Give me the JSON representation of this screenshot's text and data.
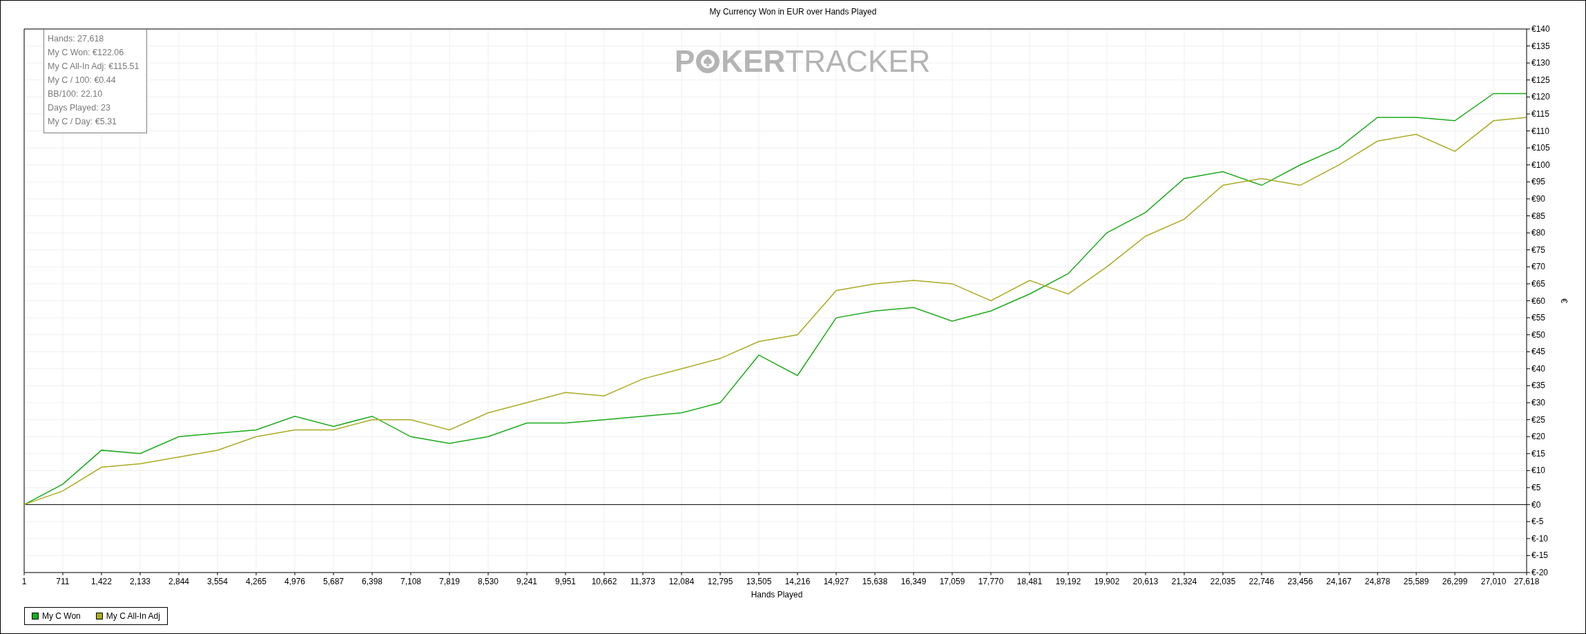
{
  "title": "My Currency Won in EUR over Hands Played",
  "stats": [
    "Hands: 27,618",
    "My C Won: €122.06",
    "My C All-In Adj: €115.51",
    "My C / 100: €0.44",
    "BB/100: 22.10",
    "Days Played: 23",
    "My C / Day: €5.31"
  ],
  "watermark": {
    "first": "P",
    "rest": "**KER**TRACKER"
  },
  "chart_data": {
    "type": "line",
    "grid": true,
    "xlabel": "Hands Played",
    "ylabel": "€",
    "x": [
      1,
      711,
      1422,
      2133,
      2844,
      3554,
      4265,
      4976,
      5687,
      6398,
      7108,
      7819,
      8530,
      9241,
      9951,
      10662,
      11373,
      12084,
      12795,
      13505,
      14216,
      14927,
      15638,
      16349,
      17059,
      17770,
      18481,
      19192,
      19902,
      20613,
      21324,
      22035,
      22746,
      23456,
      24167,
      24878,
      25589,
      26299,
      27010,
      27618
    ],
    "series": [
      {
        "name": "My C Won",
        "color": "#1aaa1a",
        "values": [
          0,
          6,
          16,
          15,
          20,
          21,
          22,
          26,
          23,
          26,
          20,
          18,
          20,
          24,
          24,
          25,
          26,
          27,
          30,
          44,
          38,
          55,
          57,
          58,
          54,
          57,
          62,
          68,
          80,
          86,
          96,
          98,
          94,
          100,
          105,
          114,
          114,
          113,
          121,
          121
        ]
      },
      {
        "name": "My C All-In Adj",
        "color": "#aaaa22",
        "values": [
          0,
          4,
          11,
          12,
          14,
          16,
          20,
          22,
          22,
          25,
          25,
          22,
          27,
          30,
          33,
          32,
          37,
          40,
          43,
          48,
          50,
          63,
          65,
          66,
          65,
          60,
          66,
          62,
          70,
          79,
          84,
          94,
          96,
          94,
          100,
          107,
          109,
          104,
          113,
          114
        ]
      }
    ],
    "xlim": [
      1,
      27618
    ],
    "ylim": [
      -20,
      140
    ],
    "xticks": [
      {
        "value": 1,
        "label": "1"
      },
      {
        "value": 711,
        "label": "711"
      },
      {
        "value": 1422,
        "label": "1,422"
      },
      {
        "value": 2133,
        "label": "2,133"
      },
      {
        "value": 2844,
        "label": "2,844"
      },
      {
        "value": 3554,
        "label": "3,554"
      },
      {
        "value": 4265,
        "label": "4,265"
      },
      {
        "value": 4976,
        "label": "4,976"
      },
      {
        "value": 5687,
        "label": "5,687"
      },
      {
        "value": 6398,
        "label": "6,398"
      },
      {
        "value": 7108,
        "label": "7,108"
      },
      {
        "value": 7819,
        "label": "7,819"
      },
      {
        "value": 8530,
        "label": "8,530"
      },
      {
        "value": 9241,
        "label": "9,241"
      },
      {
        "value": 9951,
        "label": "9,951"
      },
      {
        "value": 10662,
        "label": "10,662"
      },
      {
        "value": 11373,
        "label": "11,373"
      },
      {
        "value": 12084,
        "label": "12,084"
      },
      {
        "value": 12795,
        "label": "12,795"
      },
      {
        "value": 13505,
        "label": "13,505"
      },
      {
        "value": 14216,
        "label": "14,216"
      },
      {
        "value": 14927,
        "label": "14,927"
      },
      {
        "value": 15638,
        "label": "15,638"
      },
      {
        "value": 16349,
        "label": "16,349"
      },
      {
        "value": 17059,
        "label": "17,059"
      },
      {
        "value": 17770,
        "label": "17,770"
      },
      {
        "value": 18481,
        "label": "18,481"
      },
      {
        "value": 19192,
        "label": "19,192"
      },
      {
        "value": 19902,
        "label": "19,902"
      },
      {
        "value": 20613,
        "label": "20,613"
      },
      {
        "value": 21324,
        "label": "21,324"
      },
      {
        "value": 22035,
        "label": "22,035"
      },
      {
        "value": 22746,
        "label": "22,746"
      },
      {
        "value": 23456,
        "label": "23,456"
      },
      {
        "value": 24167,
        "label": "24,167"
      },
      {
        "value": 24878,
        "label": "24,878"
      },
      {
        "value": 25589,
        "label": "25,589"
      },
      {
        "value": 26299,
        "label": "26,299"
      },
      {
        "value": 27010,
        "label": "27,010"
      },
      {
        "value": 27618,
        "label": "27,618"
      }
    ],
    "yticks": [
      {
        "value": -20,
        "label": "€-20"
      },
      {
        "value": -15,
        "label": "€-15"
      },
      {
        "value": -10,
        "label": "€-10"
      },
      {
        "value": -5,
        "label": "€-5"
      },
      {
        "value": 0,
        "label": "€0"
      },
      {
        "value": 5,
        "label": "€5"
      },
      {
        "value": 10,
        "label": "€10"
      },
      {
        "value": 15,
        "label": "€15"
      },
      {
        "value": 20,
        "label": "€20"
      },
      {
        "value": 25,
        "label": "€25"
      },
      {
        "value": 30,
        "label": "€30"
      },
      {
        "value": 35,
        "label": "€35"
      },
      {
        "value": 40,
        "label": "€40"
      },
      {
        "value": 45,
        "label": "€45"
      },
      {
        "value": 50,
        "label": "€50"
      },
      {
        "value": 55,
        "label": "€55"
      },
      {
        "value": 60,
        "label": "€60"
      },
      {
        "value": 65,
        "label": "€65"
      },
      {
        "value": 70,
        "label": "€70"
      },
      {
        "value": 75,
        "label": "€75"
      },
      {
        "value": 80,
        "label": "€80"
      },
      {
        "value": 85,
        "label": "€85"
      },
      {
        "value": 90,
        "label": "€90"
      },
      {
        "value": 95,
        "label": "€95"
      },
      {
        "value": 100,
        "label": "€100"
      },
      {
        "value": 105,
        "label": "€105"
      },
      {
        "value": 110,
        "label": "€110"
      },
      {
        "value": 115,
        "label": "€115"
      },
      {
        "value": 120,
        "label": "€120"
      },
      {
        "value": 125,
        "label": "€125"
      },
      {
        "value": 130,
        "label": "€130"
      },
      {
        "value": 135,
        "label": "€135"
      },
      {
        "value": 140,
        "label": "€140"
      }
    ]
  }
}
